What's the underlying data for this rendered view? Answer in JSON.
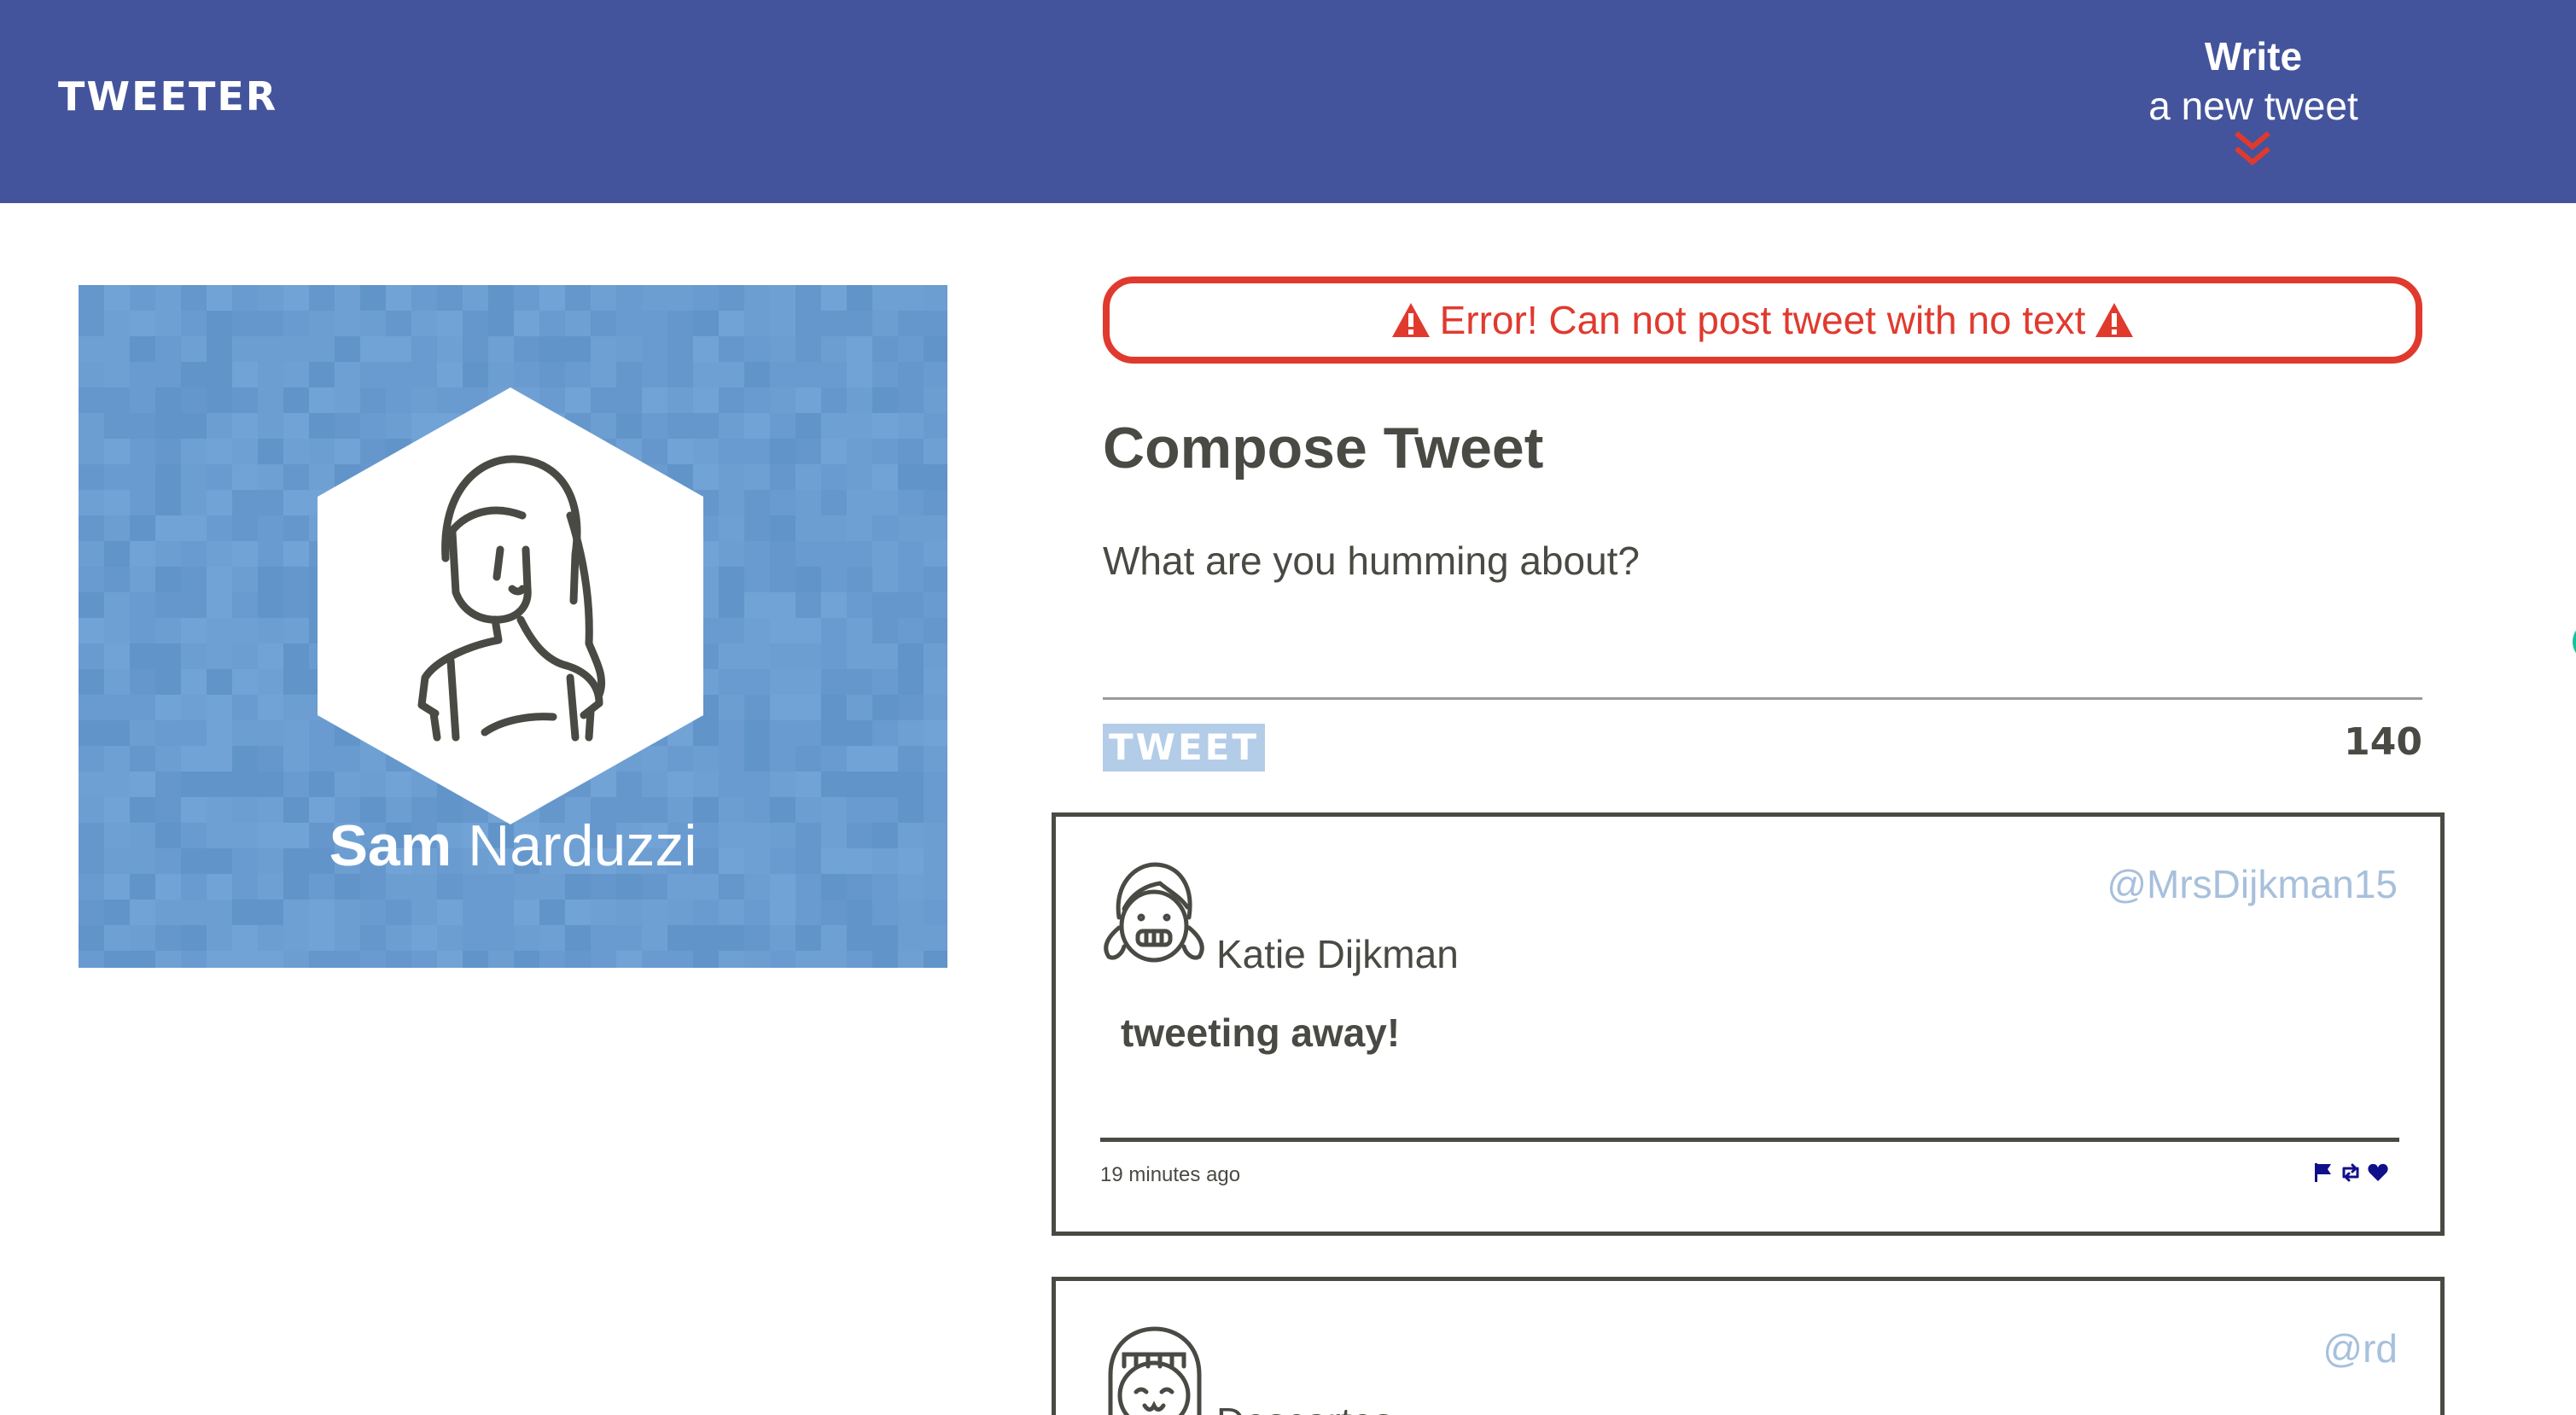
{
  "nav": {
    "brand": "TWEETER",
    "write_bold": "Write",
    "write_sub": "a new tweet",
    "bg_color": "#44549c",
    "chevron_icon": "double-chevron-down-icon",
    "chevron_color": "#e03a2e"
  },
  "profile": {
    "first_name": "Sam",
    "last_name": "Narduzzi",
    "bg_color": "#6a9bd0"
  },
  "error": {
    "message": "Error! Can not post tweet with no text",
    "icon": "warning-icon",
    "color": "#e03a2e"
  },
  "compose": {
    "title": "Compose Tweet",
    "placeholder": "What are you humming about?",
    "button_label": "TWEET",
    "counter": "140"
  },
  "tweets": [
    {
      "name": "Katie Dijkman",
      "handle": "@MrsDijkman15",
      "content": "tweeting away!",
      "time": "19 minutes ago"
    },
    {
      "name": "Descartes",
      "handle": "@rd"
    }
  ],
  "colors": {
    "text": "#4a4a44",
    "handle": "#a7c0dc",
    "action_icons": "#10108a"
  }
}
